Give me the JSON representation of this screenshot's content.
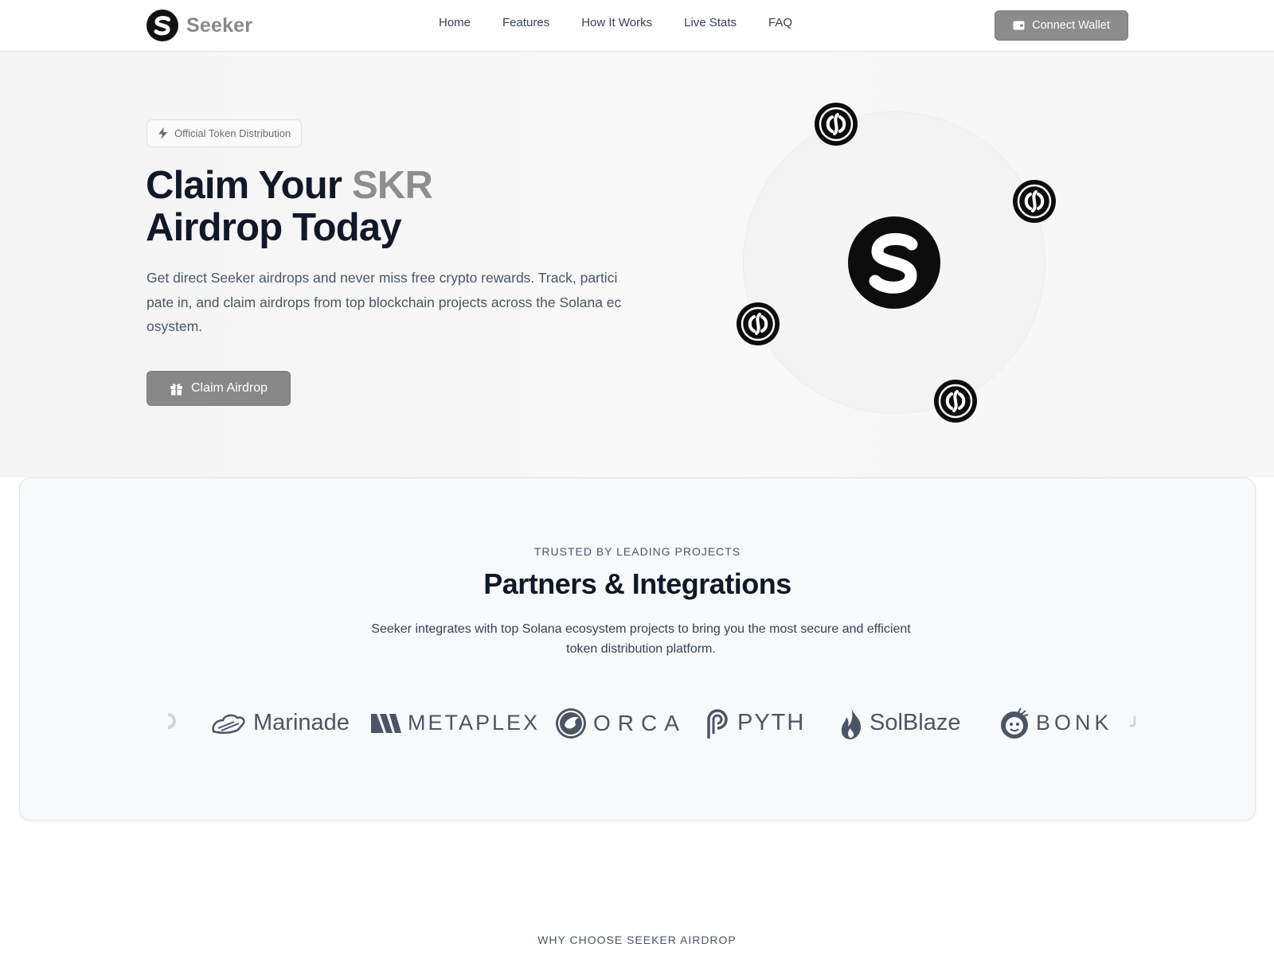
{
  "nav": {
    "brand_name": "Seeker",
    "links": [
      "Home",
      "Features",
      "How It Works",
      "Live Stats",
      "FAQ"
    ],
    "connect_label": "Connect Wallet"
  },
  "hero": {
    "badge": "Official Token Distribution",
    "title_part1": "Claim Your ",
    "title_accent": "SKR",
    "title_part2": "Airdrop Today",
    "description": "Get direct Seeker airdrops and never miss free crypto rewards. Track, participate in, and claim airdrops from top blockchain projects across the Solana ecosystem.",
    "cta_label": "Claim Airdrop"
  },
  "partners": {
    "eyebrow": "TRUSTED BY LEADING PROJECTS",
    "title": "Partners & Integrations",
    "description": "Seeker integrates with top Solana ecosystem projects to bring you the most secure and efficient token distribution platform.",
    "logos": [
      "Marinade",
      "METAPLEX",
      "ORCA",
      "PYTH",
      "SolBlaze",
      "BONK"
    ]
  },
  "next_section": {
    "eyebrow": "WHY CHOOSE SEEKER AIRDROP"
  },
  "colors": {
    "accent_gray": "#8e8e8e",
    "button_gray": "#888888",
    "text_dark": "#111827",
    "text_body": "#4b5563"
  },
  "icons": [
    "seeker-logo-icon",
    "wallet-icon",
    "lightning-icon",
    "gift-icon",
    "token-coin-icon",
    "marinade-logo-icon",
    "metaplex-logo-icon",
    "orca-logo-icon",
    "pyth-logo-icon",
    "solblaze-logo-icon",
    "bonk-logo-icon"
  ]
}
